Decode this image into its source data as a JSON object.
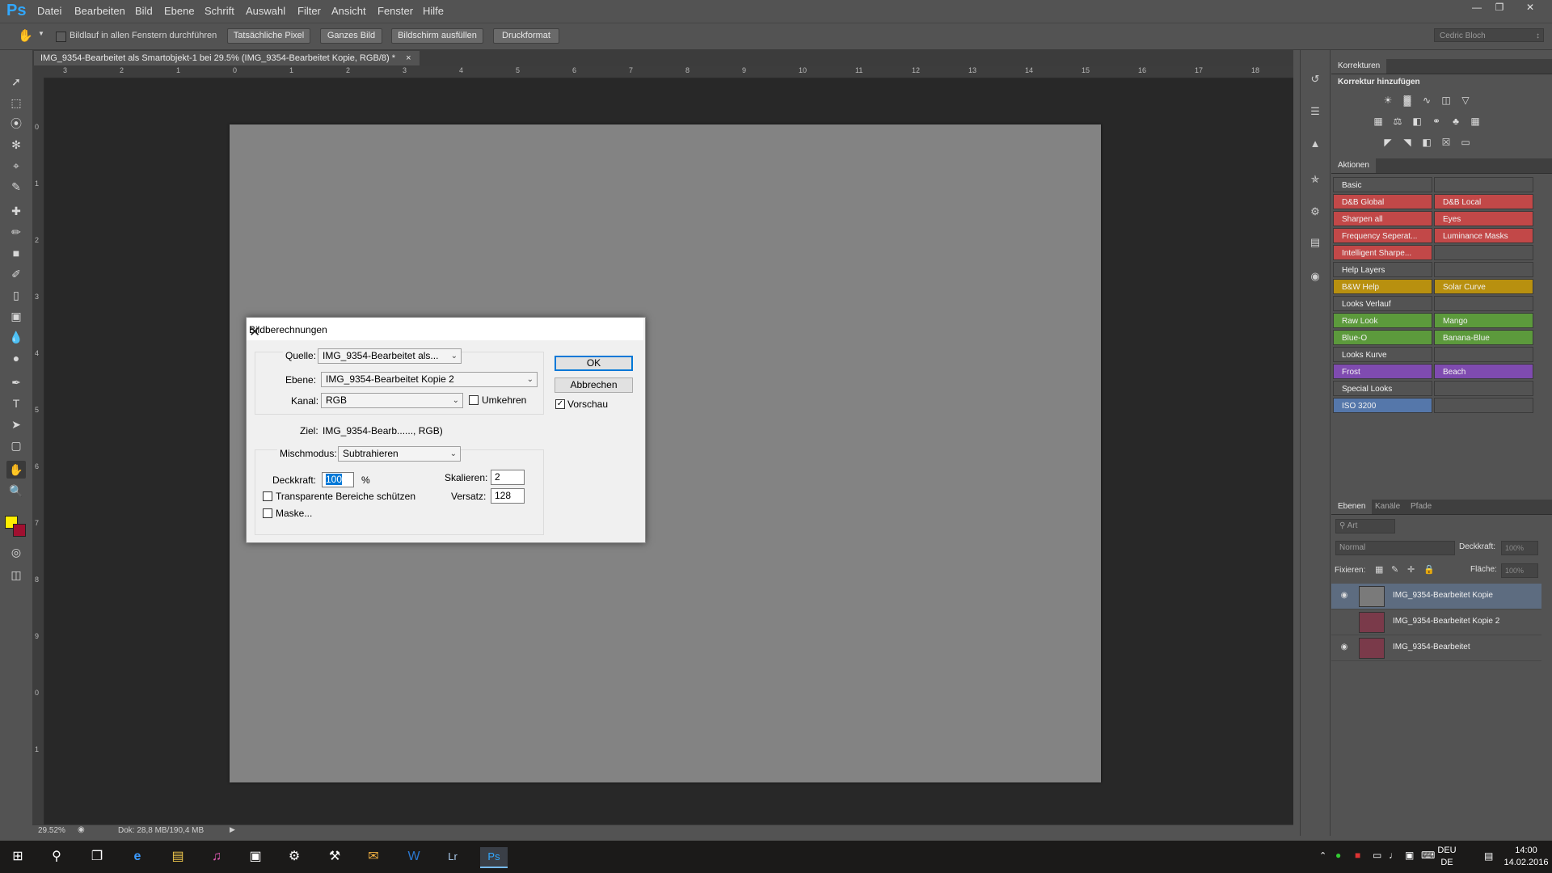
{
  "app": {
    "logo": "Ps"
  },
  "menu": [
    "Datei",
    "Bearbeiten",
    "Bild",
    "Ebene",
    "Schrift",
    "Auswahl",
    "Filter",
    "Ansicht",
    "Fenster",
    "Hilfe"
  ],
  "options_bar": {
    "scroll_all_label": "Bildlauf in allen Fenstern durchführen",
    "buttons": [
      "Tatsächliche Pixel",
      "Ganzes Bild",
      "Bildschirm ausfüllen",
      "Druckformat"
    ],
    "user": "Cedric Bloch"
  },
  "document_tab": {
    "title": "IMG_9354-Bearbeitet als Smartobjekt-1 bei 29.5% (IMG_9354-Bearbeitet Kopie, RGB/8) *",
    "close": "×"
  },
  "ruler_top": [
    "3",
    "2",
    "1",
    "0",
    "1",
    "2",
    "3",
    "4",
    "5",
    "6",
    "7",
    "8",
    "9",
    "10",
    "11",
    "12",
    "13",
    "14",
    "15",
    "16",
    "17",
    "18"
  ],
  "ruler_left": [
    "0",
    "1",
    "2",
    "3",
    "4",
    "5",
    "6",
    "7",
    "8",
    "9",
    "0",
    "1"
  ],
  "status": {
    "zoom": "29.52%",
    "doc": "Dok: 28,8 MB/190,4 MB"
  },
  "panels": {
    "corrections_tab": "Korrekturen",
    "corrections_heading": "Korrektur hinzufügen",
    "actions_tab": "Aktionen",
    "actions": [
      {
        "left": "Basic",
        "right": "",
        "color": "#535353"
      },
      {
        "left": "D&B Global",
        "right": "D&B Local",
        "color": "#c24848"
      },
      {
        "left": "Sharpen all",
        "right": "Eyes",
        "color": "#c24848"
      },
      {
        "left": "Frequency Seperat...",
        "right": "Luminance Masks",
        "color": "#c24848"
      },
      {
        "left": "Intelligent Sharpe...",
        "right": "",
        "color": "#c24848",
        "right_color": "#535353"
      },
      {
        "left": "Help Layers",
        "right": "",
        "color": "#535353"
      },
      {
        "left": "B&W Help",
        "right": "Solar Curve",
        "color": "#b8900f"
      },
      {
        "left": "Looks Verlauf",
        "right": "",
        "color": "#535353"
      },
      {
        "left": "Raw Look",
        "right": "Mango",
        "color": "#5c9a3c"
      },
      {
        "left": "Blue-O",
        "right": "Banana-Blue",
        "color": "#5c9a3c"
      },
      {
        "left": "Looks Kurve",
        "right": "",
        "color": "#535353"
      },
      {
        "left": "Frost",
        "right": "Beach",
        "color": "#7f4bb0"
      },
      {
        "left": "Special Looks",
        "right": "",
        "color": "#535353"
      },
      {
        "left": "ISO 3200",
        "right": "",
        "color": "#5577aa",
        "right_color": "#535353"
      }
    ],
    "layers_tabs": [
      "Ebenen",
      "Kanäle",
      "Pfade"
    ],
    "layer_filter": "Art",
    "blend_mode": "Normal",
    "opacity_label": "Deckkraft:",
    "opacity_value": "100%",
    "lock_label": "Fixieren:",
    "fill_label": "Fläche:",
    "fill_value": "100%",
    "layers": [
      {
        "name": "IMG_9354-Bearbeitet Kopie",
        "visible": true,
        "selected": true,
        "thumb": "#7a7a7a"
      },
      {
        "name": "IMG_9354-Bearbeitet Kopie 2",
        "visible": false,
        "selected": false,
        "thumb": "#7a3a4a"
      },
      {
        "name": "IMG_9354-Bearbeitet",
        "visible": true,
        "selected": false,
        "thumb": "#7a3a4a"
      }
    ]
  },
  "dialog": {
    "title": "Bildberechnungen",
    "quelle_label": "Quelle:",
    "quelle_value": "IMG_9354-Bearbeitet als...",
    "ebene_label": "Ebene:",
    "ebene_value": "IMG_9354-Bearbeitet Kopie 2",
    "kanal_label": "Kanal:",
    "kanal_value": "RGB",
    "umkehren_label": "Umkehren",
    "ziel_label": "Ziel:",
    "ziel_value": "IMG_9354-Bearb......, RGB)",
    "mischmodus_label": "Mischmodus:",
    "mischmodus_value": "Subtrahieren",
    "deckkraft_label": "Deckkraft:",
    "deckkraft_value": "100",
    "percent": "%",
    "skalieren_label": "Skalieren:",
    "skalieren_value": "2",
    "versatz_label": "Versatz:",
    "versatz_value": "128",
    "transparent_label": "Transparente Bereiche schützen",
    "maske_label": "Maske...",
    "ok_label": "OK",
    "cancel_label": "Abbrechen",
    "vorschau_label": "Vorschau",
    "vorschau_checked": true
  },
  "taskbar": {
    "lang_top": "DEU",
    "lang_bottom": "DE",
    "time": "14:00",
    "date": "14.02.2016"
  }
}
